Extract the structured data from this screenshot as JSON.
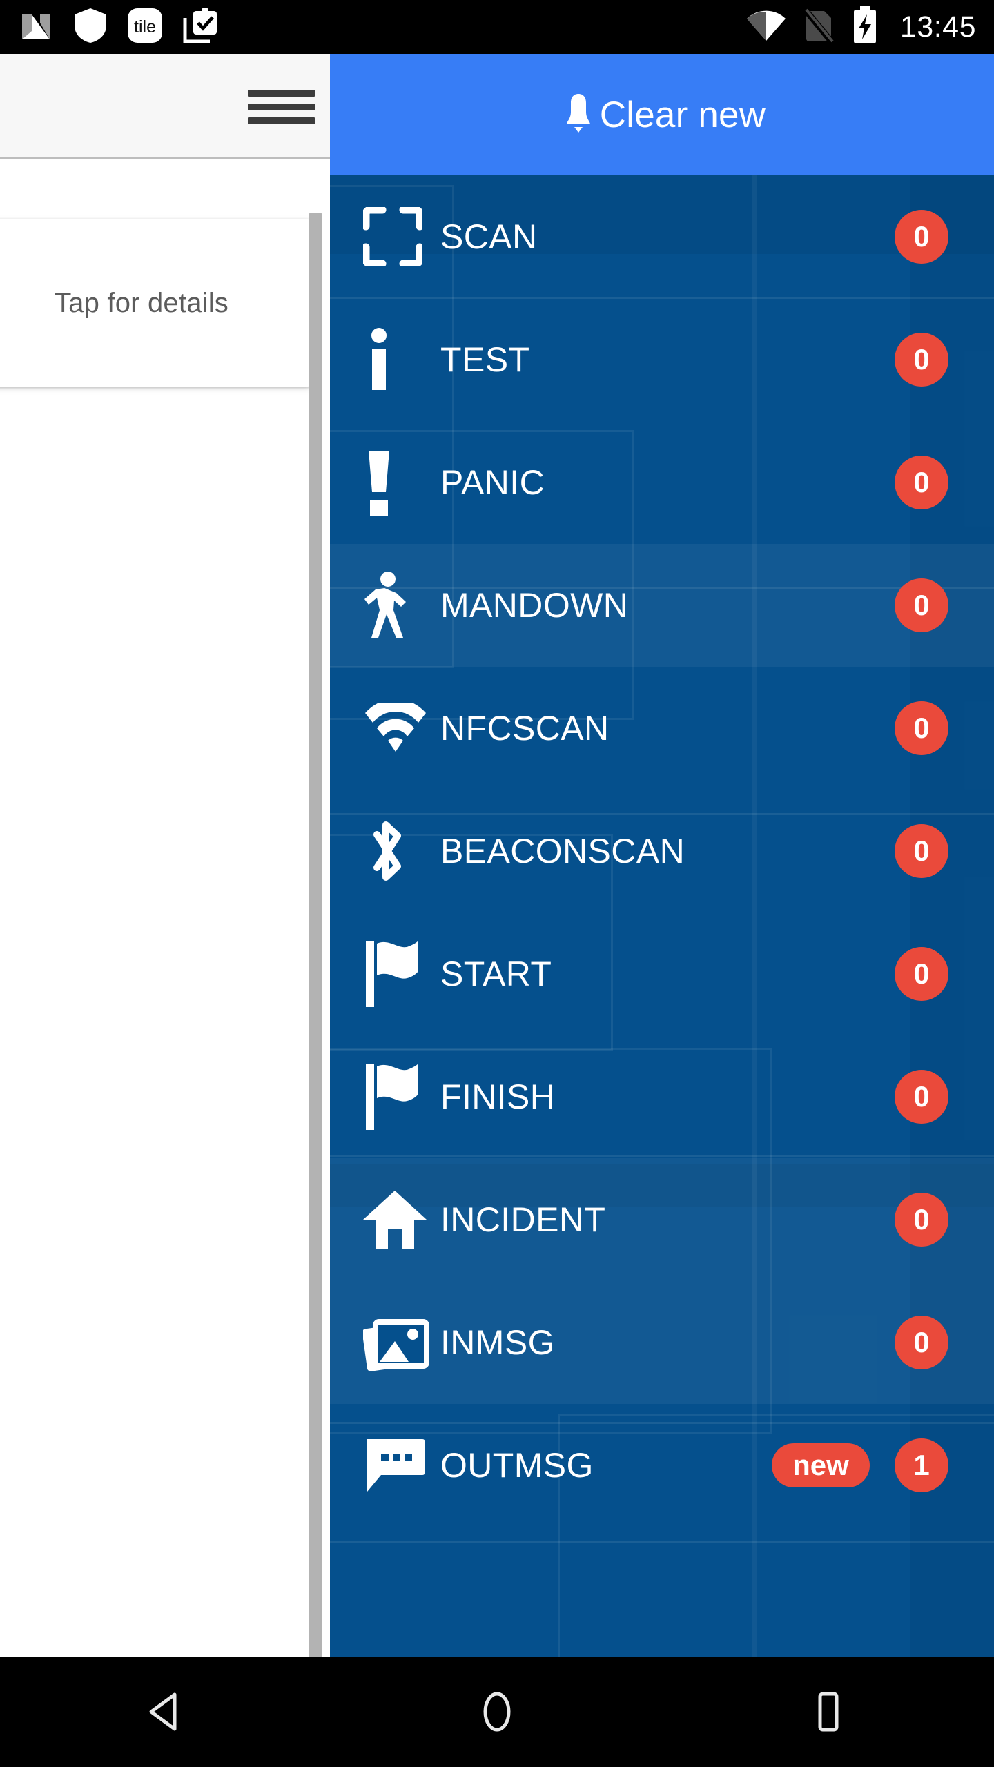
{
  "status_bar": {
    "time": "13:45",
    "left_icons": [
      {
        "name": "android-nougat-icon"
      },
      {
        "name": "shield-icon"
      },
      {
        "name": "tile-app-icon",
        "label": "tile"
      },
      {
        "name": "clipboard-check-icon"
      }
    ],
    "right_icons": [
      {
        "name": "wifi-icon"
      },
      {
        "name": "no-sim-icon"
      },
      {
        "name": "battery-charging-icon"
      }
    ]
  },
  "left_screen": {
    "menu_button_label": "Menu",
    "detail_card_text": "Tap for details"
  },
  "drawer": {
    "header": {
      "label": "Clear new",
      "icon": "bell-icon",
      "background": "#377DF6"
    },
    "background": "#05508D",
    "badge_color": "#EA4A3B",
    "items": [
      {
        "label": "SCAN",
        "icon": "scan-frame-icon",
        "count": "0",
        "tag": "",
        "highlighted": false
      },
      {
        "label": "TEST",
        "icon": "info-icon",
        "count": "0",
        "tag": "",
        "highlighted": false
      },
      {
        "label": "PANIC",
        "icon": "exclamation-icon",
        "count": "0",
        "tag": "",
        "highlighted": false
      },
      {
        "label": "MANDOWN",
        "icon": "walking-man-icon",
        "count": "0",
        "tag": "",
        "highlighted": true
      },
      {
        "label": "NFCSCAN",
        "icon": "wifi-icon",
        "count": "0",
        "tag": "",
        "highlighted": false
      },
      {
        "label": "BEACONSCAN",
        "icon": "bluetooth-icon",
        "count": "0",
        "tag": "",
        "highlighted": false
      },
      {
        "label": "START",
        "icon": "flag-icon",
        "count": "0",
        "tag": "",
        "highlighted": false
      },
      {
        "label": "FINISH",
        "icon": "flag-icon",
        "count": "0",
        "tag": "",
        "highlighted": false
      },
      {
        "label": "INCIDENT",
        "icon": "home-icon",
        "count": "0",
        "tag": "",
        "highlighted": true
      },
      {
        "label": "INMSG",
        "icon": "photos-icon",
        "count": "0",
        "tag": "",
        "highlighted": true
      },
      {
        "label": "OUTMSG",
        "icon": "chat-bubble-icon",
        "count": "1",
        "tag": "new",
        "highlighted": false
      }
    ]
  },
  "nav_bar": {
    "back_label": "Back",
    "home_label": "Home",
    "recents_label": "Recents"
  }
}
